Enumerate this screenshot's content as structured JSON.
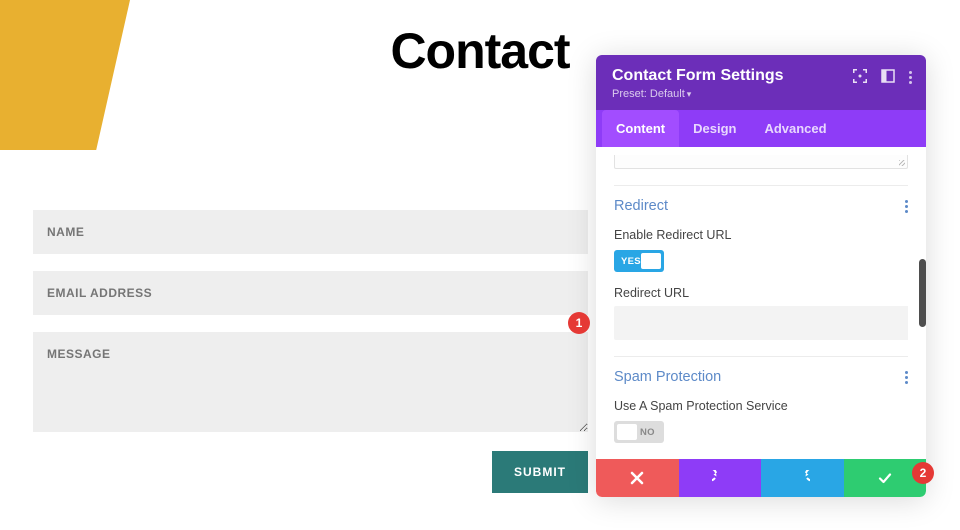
{
  "page": {
    "title": "Contact",
    "form": {
      "name_placeholder": "NAME",
      "email_placeholder": "EMAIL ADDRESS",
      "message_placeholder": "MESSAGE",
      "submit_label": "SUBMIT"
    }
  },
  "panel": {
    "title": "Contact Form Settings",
    "preset_label": "Preset: Default",
    "tabs": {
      "content": "Content",
      "design": "Design",
      "advanced": "Advanced"
    },
    "redirect": {
      "section_title": "Redirect",
      "enable_label": "Enable Redirect URL",
      "enable_state": "YES",
      "url_label": "Redirect URL",
      "url_value": ""
    },
    "spam": {
      "section_title": "Spam Protection",
      "service_label": "Use A Spam Protection Service",
      "service_state": "NO"
    }
  },
  "badges": {
    "one": "1",
    "two": "2"
  }
}
